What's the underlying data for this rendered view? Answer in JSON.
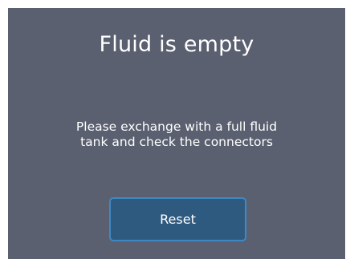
{
  "dialog": {
    "title": "Fluid is empty",
    "message_lines": [
      "Please exchange with a full fluid",
      "tank and check the connectors"
    ],
    "reset_label": "Reset"
  },
  "colors": {
    "dialog_background": "#5a6070",
    "button_background": "#2f5a80",
    "button_border": "#3f88c5",
    "text": "#ffffff"
  }
}
